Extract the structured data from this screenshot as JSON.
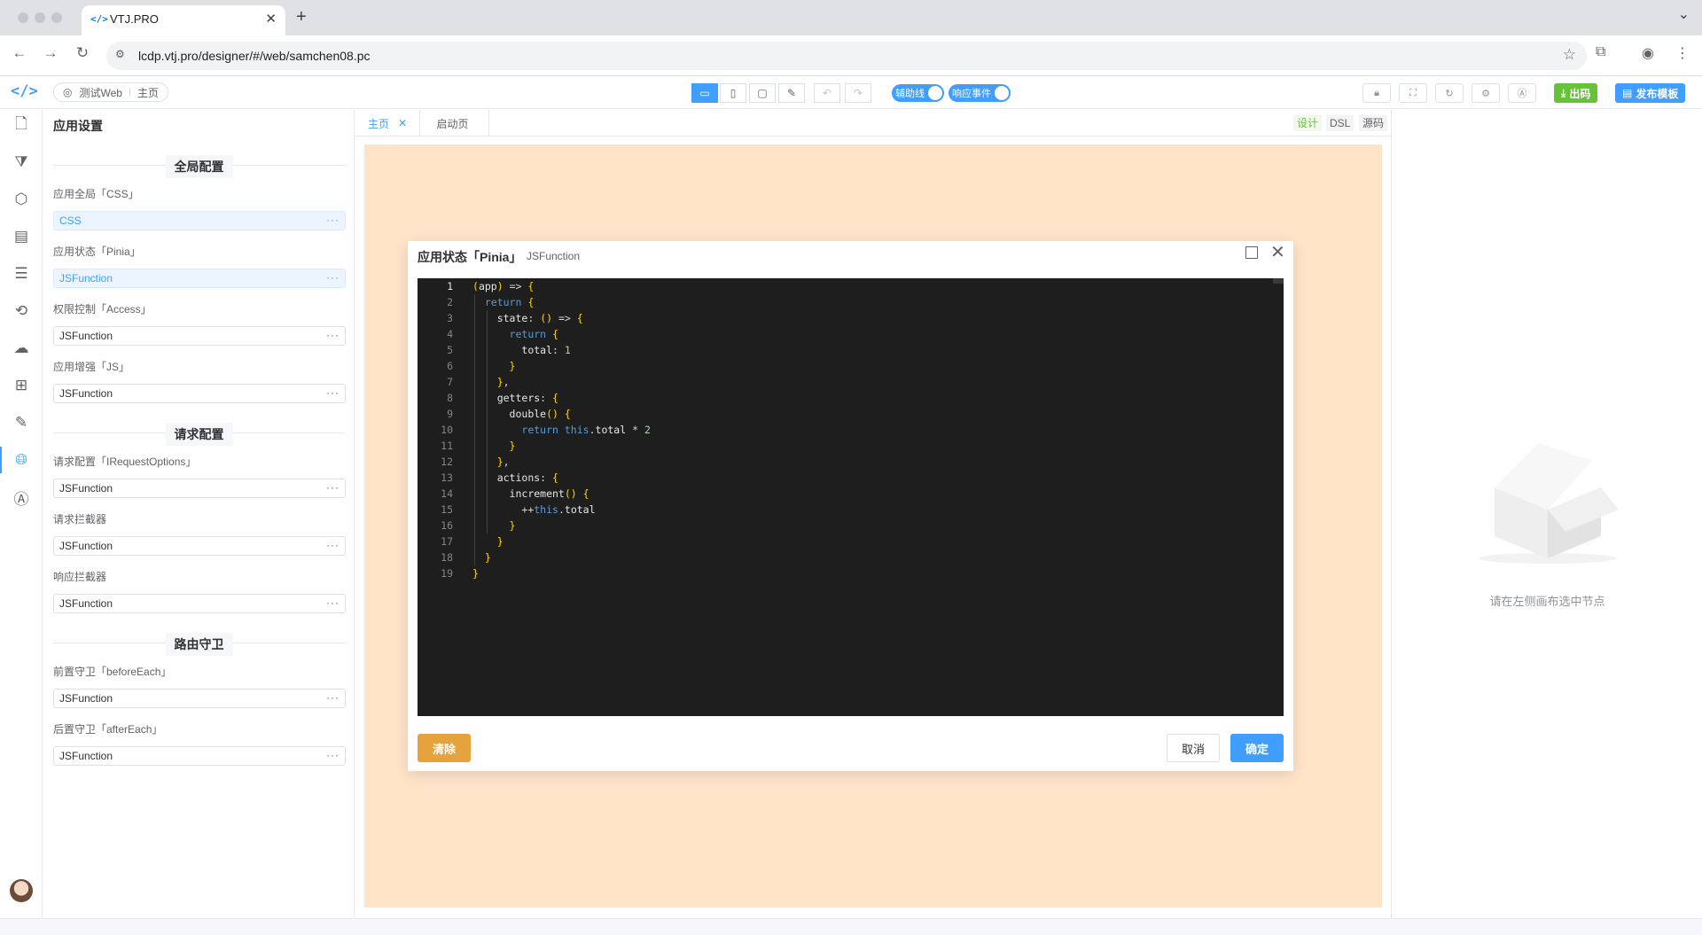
{
  "browser": {
    "tab_title": "VTJ.PRO",
    "url": "lcdp.vtj.pro/designer/#/web/samchen08.pc"
  },
  "header": {
    "project_name": "测试Web",
    "page_name": "主页",
    "toggle_guides": "辅助线",
    "toggle_events": "响应事件",
    "export_label": "出码",
    "publish_label": "发布模板"
  },
  "sidebar": {
    "icons": [
      "pages-icon",
      "plugin-icon",
      "component-icon",
      "layout-icon",
      "outline-icon",
      "history-icon",
      "api-cloud-icon",
      "apps-icon",
      "edit-doc-icon",
      "globe-icon",
      "ai-icon"
    ],
    "active": "globe-icon"
  },
  "settings": {
    "title": "应用设置",
    "section_global": "全局配置",
    "section_request": "请求配置",
    "section_route": "路由守卫",
    "fields": [
      {
        "label": "应用全局「CSS」",
        "value": "CSS"
      },
      {
        "label": "应用状态「Pinia」",
        "value": "JSFunction"
      },
      {
        "label": "权限控制「Access」",
        "value": "JSFunction"
      },
      {
        "label": "应用增强「JS」",
        "value": "JSFunction"
      },
      {
        "label": "请求配置「IRequestOptions」",
        "value": "JSFunction"
      },
      {
        "label": "请求拦截器",
        "value": "JSFunction"
      },
      {
        "label": "响应拦截器",
        "value": "JSFunction"
      },
      {
        "label": "前置守卫「beforeEach」",
        "value": "JSFunction"
      },
      {
        "label": "后置守卫「afterEach」",
        "value": "JSFunction"
      }
    ],
    "more": "···"
  },
  "canvas": {
    "tabs": [
      "主页",
      "启动页"
    ],
    "views": [
      "设计",
      "DSL",
      "源码"
    ]
  },
  "dialog": {
    "title": "应用状态「Pinia」",
    "subtitle": "JSFunction",
    "clear": "清除",
    "cancel": "取消",
    "ok": "确定",
    "code": [
      "(app) => {",
      "  return {",
      "    state: () => {",
      "      return {",
      "        total: 1",
      "      }",
      "    },",
      "    getters: {",
      "      double() {",
      "        return this.total * 2",
      "      }",
      "    },",
      "    actions: {",
      "      increment() {",
      "        ++this.total",
      "      }",
      "    }",
      "  }",
      "}"
    ]
  },
  "right_panel": {
    "empty_text": "请在左侧画布选中节点"
  },
  "colors": {
    "primary": "#409eff",
    "warning": "#e6a23c",
    "success": "#67c23a",
    "canvas_bg": "#ffe4c8",
    "editor_bg": "#1e1e1e"
  }
}
